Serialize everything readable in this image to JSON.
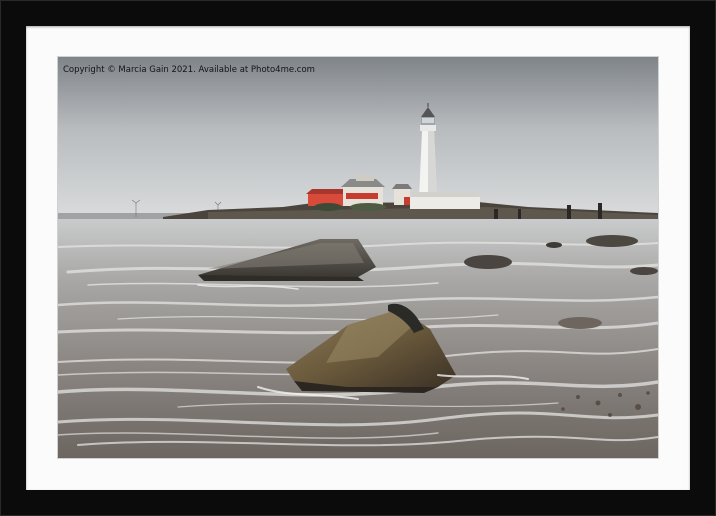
{
  "photo": {
    "watermark": "Copyright © Marcia Gain 2021. Available at Photo4me.com",
    "subject": "lighthouse",
    "colors": {
      "frame": "#0b0b0b",
      "mount": "#fbfbfb",
      "sky": "#c9cdd0",
      "water": "#8c8a87",
      "rock": "#6b5a3c",
      "building_roof": "#c83b2f"
    }
  }
}
